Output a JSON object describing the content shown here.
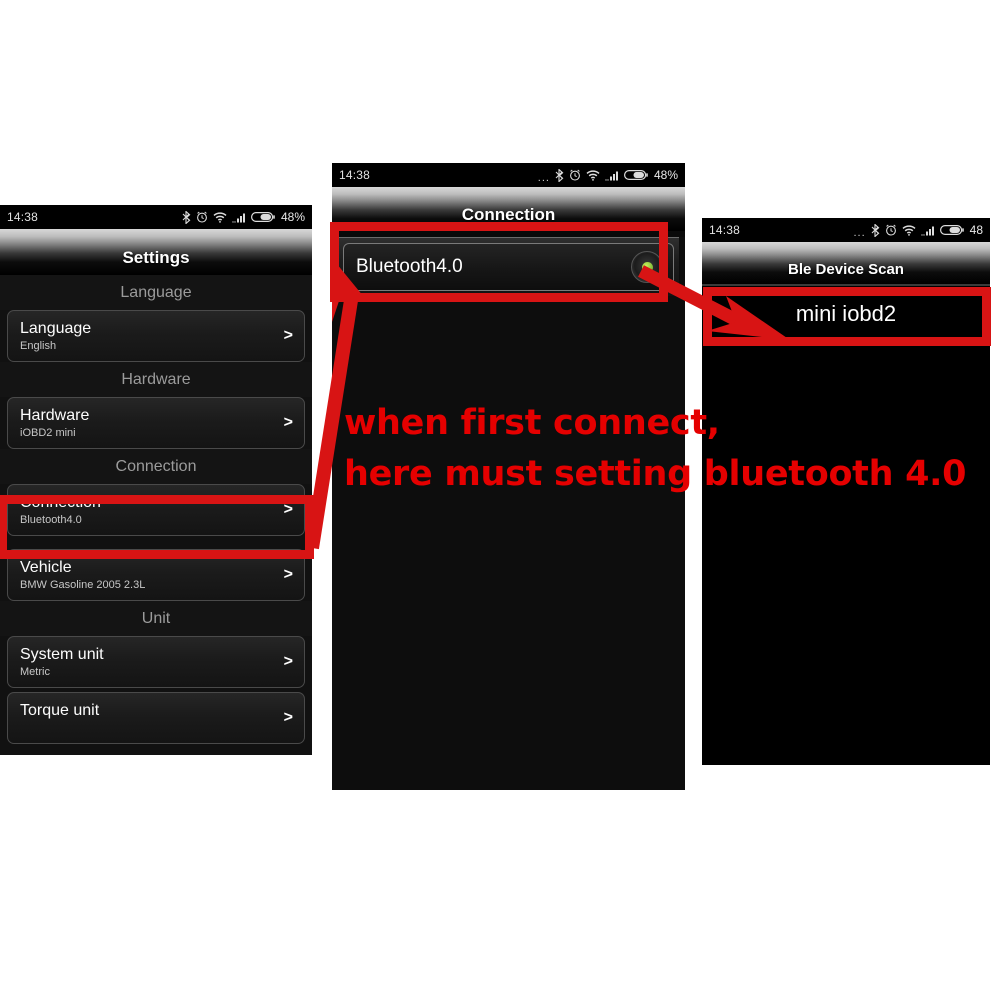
{
  "screens": {
    "settings": {
      "statusbar": {
        "time": "14:38",
        "battery_pct": "48%",
        "dots": "",
        "icons": [
          "bluetooth-icon",
          "alarm-icon",
          "wifi-icon",
          "signal-icon",
          "battery-icon"
        ]
      },
      "title": "Settings",
      "sections": [
        {
          "header": "Language",
          "rows": [
            {
              "title": "Language",
              "subtitle": "English",
              "chevron": ">"
            }
          ]
        },
        {
          "header": "Hardware",
          "rows": [
            {
              "title": "Hardware",
              "subtitle": "iOBD2 mini",
              "chevron": ">"
            }
          ]
        },
        {
          "header": "Connection",
          "rows": [
            {
              "title": "Connection",
              "subtitle": "Bluetooth4.0",
              "chevron": ">"
            },
            {
              "title": "Vehicle",
              "subtitle": "BMW  Gasoline  2005  2.3L",
              "chevron": ">"
            }
          ]
        },
        {
          "header": "Unit",
          "rows": [
            {
              "title": "System unit",
              "subtitle": "Metric",
              "chevron": ">"
            },
            {
              "title": "Torque unit",
              "subtitle": "",
              "chevron": ">"
            }
          ]
        }
      ]
    },
    "connection": {
      "statusbar": {
        "time": "14:38",
        "battery_pct": "48%",
        "dots": "...",
        "icons": [
          "bluetooth-icon",
          "alarm-icon",
          "wifi-icon",
          "signal-icon",
          "battery-icon"
        ]
      },
      "title": "Connection",
      "options": [
        {
          "label": "Bluetooth4.0",
          "selected": true
        }
      ]
    },
    "scan": {
      "statusbar": {
        "time": "14:38",
        "battery_pct": "48",
        "dots": "...",
        "icons": [
          "bluetooth-icon",
          "alarm-icon",
          "wifi-icon",
          "signal-icon",
          "battery-icon"
        ]
      },
      "title": "Ble Device Scan",
      "devices": [
        {
          "name": "mini iobd2"
        }
      ]
    }
  },
  "annotation": {
    "line1": "when first connect,",
    "line2": "here must setting bluetooth 4.0",
    "color": "#e50000",
    "highlight_color": "#d81414",
    "arrows": [
      "arrow-connection-to-bluetooth",
      "arrow-bluetooth-to-device"
    ]
  },
  "colors": {
    "accent_red": "#d81414",
    "indicator_green": "#8dc63f",
    "screen_background": "#0d0d0d",
    "page_background": "#ffffff"
  }
}
